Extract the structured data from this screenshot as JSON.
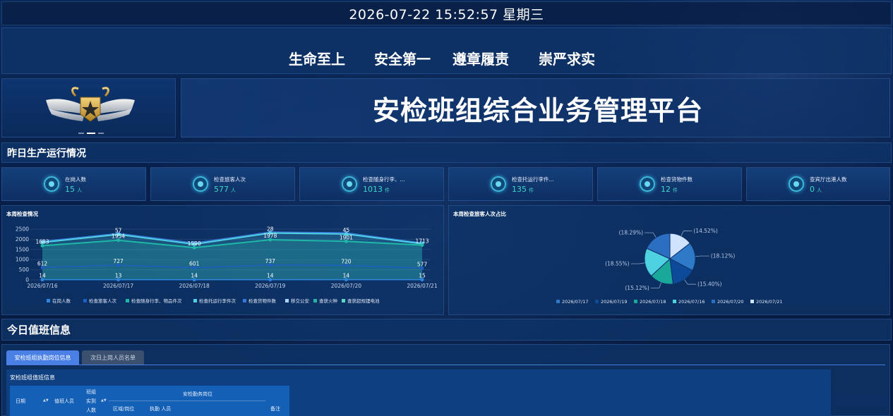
{
  "header": {
    "datetime": "2026-07-22 15:52:57 星期三",
    "slogans": [
      "生命至上",
      "安全第一",
      "遵章履责",
      "崇严求实"
    ],
    "platform_title": "安检班组综合业务管理平台"
  },
  "yesterday": {
    "section_title": "昨日生产运行情况",
    "stats": [
      {
        "label": "在岗人数",
        "value": "15",
        "unit": "人"
      },
      {
        "label": "检查旅客人次",
        "value": "577",
        "unit": "人"
      },
      {
        "label": "检查随身行李、...",
        "value": "1013",
        "unit": "件"
      },
      {
        "label": "检查托运行李件...",
        "value": "135",
        "unit": "件"
      },
      {
        "label": "检查货物件数",
        "value": "12",
        "unit": "件"
      },
      {
        "label": "查宾厅出港人数",
        "value": "0",
        "unit": "人"
      }
    ]
  },
  "weekly_chart_title": "本周检查情况",
  "ratio_chart_title": "本周检查旅客人次占比",
  "chart_data": [
    {
      "type": "line",
      "title": "本周检查情况",
      "x": [
        "2026/07/16",
        "2026/07/17",
        "2026/07/18",
        "2026/07/19",
        "2026/07/20",
        "2026/07/21"
      ],
      "ylim": [
        0,
        2500
      ],
      "yticks": [
        0,
        500,
        1000,
        1500,
        2000,
        2500
      ],
      "series": [
        {
          "name": "在岗人数",
          "color": "#2e86de",
          "values": [
            14,
            13,
            14,
            14,
            14,
            15
          ],
          "labels": [
            "14",
            "13",
            "14",
            "14",
            "14",
            "15"
          ]
        },
        {
          "name": "检查旅客人次",
          "color": "#1f5fbf",
          "values": [
            612,
            727,
            601,
            737,
            720,
            577
          ],
          "labels": [
            "612",
            "727",
            "601",
            "737",
            "720",
            "577"
          ]
        },
        {
          "name": "检查随身行李、物品件次",
          "color": "#1fb8a6",
          "values": [
            1683,
            1954,
            1590,
            1978,
            1901,
            1713
          ],
          "labels": [
            "1683",
            "1954",
            "1590",
            "1978",
            "1901",
            "1713"
          ],
          "area": true
        },
        {
          "name": "检查托运行李件次",
          "color": "#4fd1e6",
          "values": [
            1850,
            2240,
            1760,
            2310,
            2260,
            1780
          ],
          "labels": [
            "",
            "57",
            "",
            "28",
            "45",
            ""
          ],
          "area": true
        },
        {
          "name": "检查货物件数",
          "color": "#3a78d8",
          "values": [
            1900,
            2290,
            1820,
            2360,
            2320,
            1820
          ],
          "labels": []
        },
        {
          "name": "移交公安",
          "color": "#a9d4ff",
          "values": [
            0,
            0,
            0,
            0,
            0,
            0
          ],
          "labels": []
        },
        {
          "name": "查获火种",
          "color": "#2bb0a8",
          "values": [
            0,
            0,
            0,
            0,
            0,
            0
          ],
          "labels": []
        },
        {
          "name": "查获超规锂电池",
          "color": "#5fd6c8",
          "values": [
            0,
            0,
            0,
            0,
            0,
            0
          ],
          "labels": []
        }
      ]
    },
    {
      "type": "pie",
      "title": "本周检查旅客人次占比",
      "slices": [
        {
          "name": "2026/07/17",
          "percent": 18.12,
          "label": "(18.12%)",
          "color": "#2f79c9"
        },
        {
          "name": "2026/07/19",
          "percent": 15.4,
          "label": "(15.40%)",
          "color": "#0e4a9a"
        },
        {
          "name": "2026/07/18",
          "percent": 15.12,
          "label": "(15.12%)",
          "color": "#1aa89a"
        },
        {
          "name": "2026/07/16",
          "percent": 18.55,
          "label": "(18.55%)",
          "color": "#4ed1e0"
        },
        {
          "name": "2026/07/20",
          "percent": 18.29,
          "label": "(18.29%)",
          "color": "#2a6fc2"
        },
        {
          "name": "2026/07/21",
          "percent": 14.52,
          "label": "(14.52%)",
          "color": "#cfe3ff"
        }
      ]
    }
  ],
  "today": {
    "section_title": "今日值班信息",
    "tabs": [
      {
        "label": "安检班组执勤岗位信息",
        "active": true
      },
      {
        "label": "次日上岗人员名单",
        "active": false
      }
    ],
    "table_title": "安检班组值班信息",
    "table_headers": {
      "date": "日期",
      "duty_staff": "值班人员",
      "team_actual_1": "班组",
      "team_actual_2": "实到",
      "team_actual_3": "人数",
      "post_group": "安检勤务岗位",
      "area": "区域/岗位",
      "on_duty": "执勤 人员",
      "remark": "备注"
    }
  }
}
